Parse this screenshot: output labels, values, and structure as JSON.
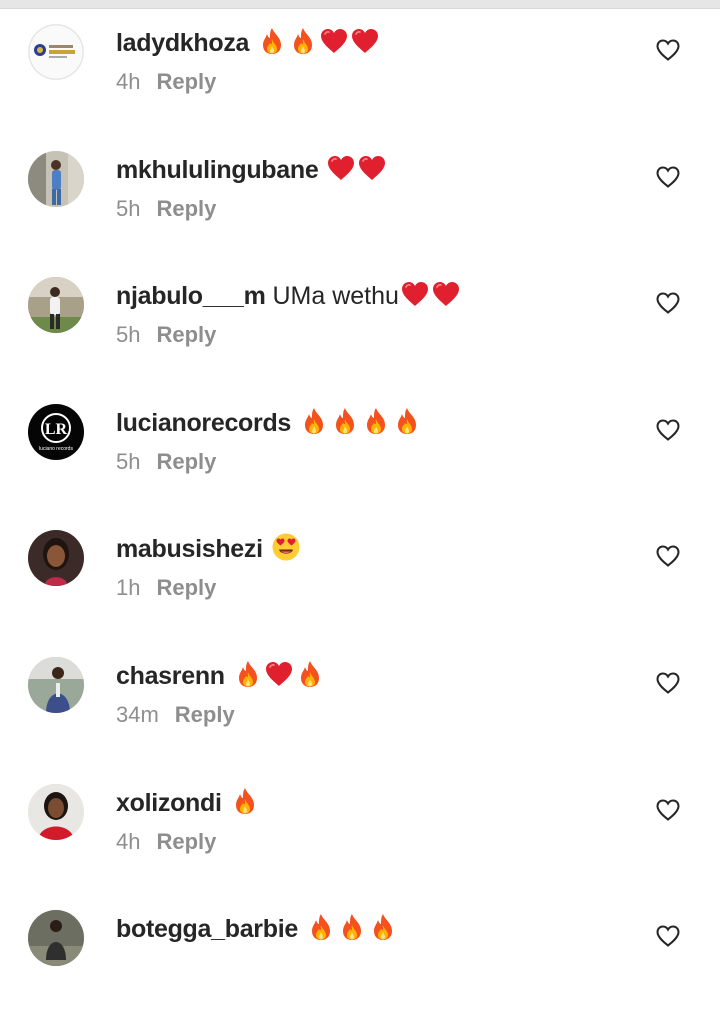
{
  "comments": [
    {
      "username": "ladydkhoza",
      "text": "",
      "emojis": [
        "fire",
        "fire",
        "heart",
        "heart"
      ],
      "time": "4h",
      "reply_label": "Reply",
      "avatar_icon": "logo-avatar"
    },
    {
      "username": "mkhululingubane",
      "text": "",
      "emojis": [
        "heart",
        "heart"
      ],
      "time": "5h",
      "reply_label": "Reply",
      "avatar_icon": "photo-avatar"
    },
    {
      "username": "njabulo___m",
      "text": "UMa wethu",
      "emojis": [
        "heart",
        "heart"
      ],
      "time": "5h",
      "reply_label": "Reply",
      "avatar_icon": "photo-avatar"
    },
    {
      "username": "lucianorecords",
      "text": "",
      "emojis": [
        "fire",
        "fire",
        "fire",
        "fire"
      ],
      "time": "5h",
      "reply_label": "Reply",
      "avatar_icon": "lr-logo-avatar"
    },
    {
      "username": "mabusishezi",
      "text": "",
      "emojis": [
        "heart-eyes"
      ],
      "time": "1h",
      "reply_label": "Reply",
      "avatar_icon": "photo-avatar"
    },
    {
      "username": "chasrenn",
      "text": "",
      "emojis": [
        "fire",
        "heart",
        "fire"
      ],
      "time": "34m",
      "reply_label": "Reply",
      "avatar_icon": "photo-avatar"
    },
    {
      "username": "xolizondi",
      "text": "",
      "emojis": [
        "fire"
      ],
      "time": "4h",
      "reply_label": "Reply",
      "avatar_icon": "photo-avatar"
    },
    {
      "username": "botegga_barbie",
      "text": "",
      "emojis": [
        "fire",
        "fire",
        "fire"
      ],
      "time": "",
      "reply_label": "",
      "avatar_icon": "photo-avatar"
    }
  ],
  "colors": {
    "username": "#262626",
    "meta": "#8e8e8e",
    "fire": "#f4511e",
    "heart": "#e0202e"
  }
}
